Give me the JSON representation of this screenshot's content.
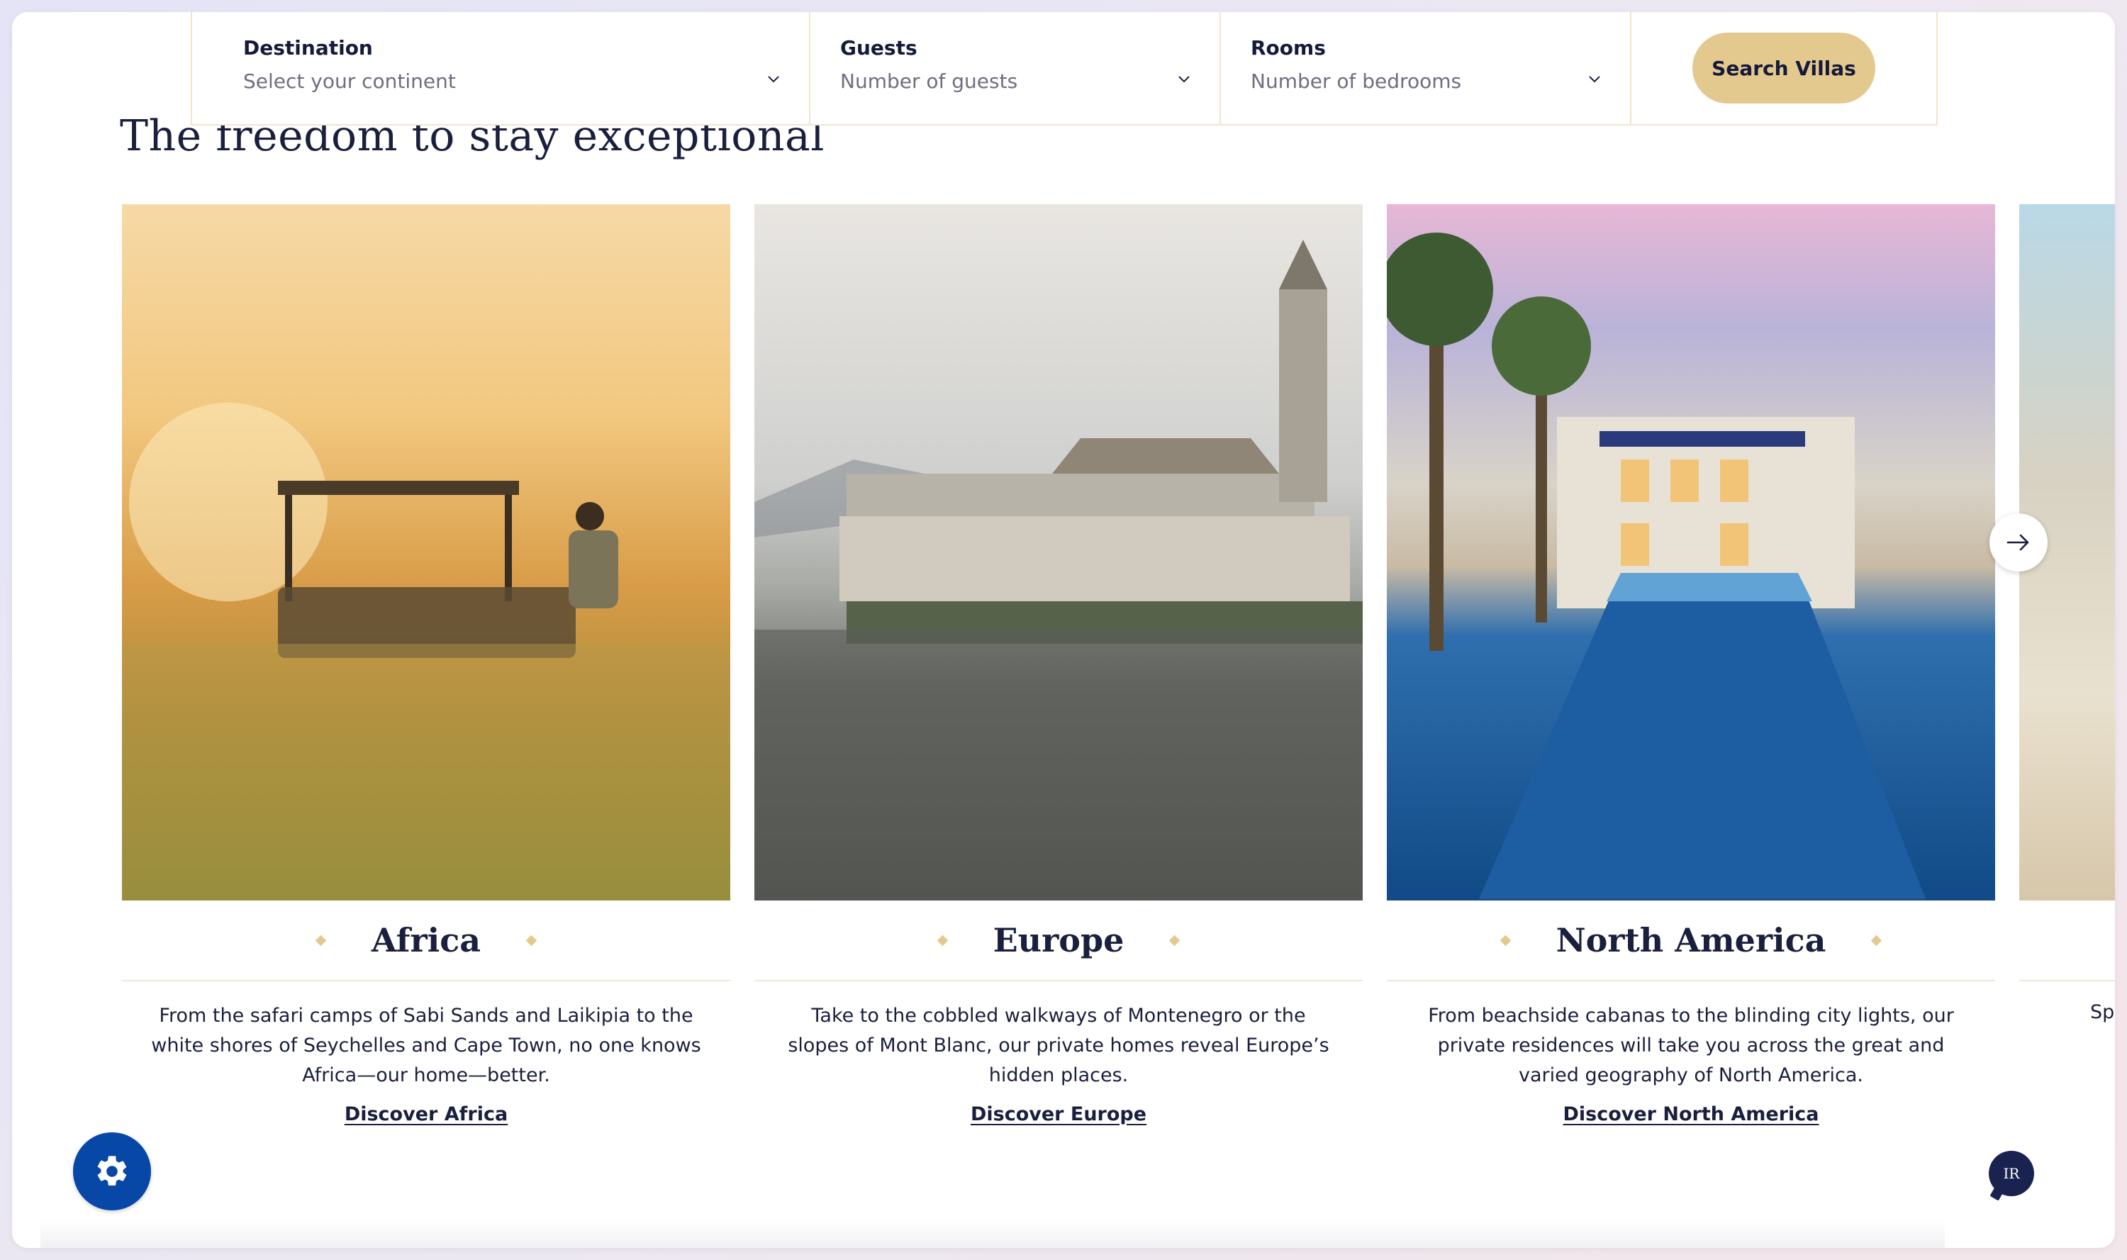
{
  "search": {
    "destination": {
      "label": "Destination",
      "value": "Select your continent"
    },
    "guests": {
      "label": "Guests",
      "value": "Number of guests"
    },
    "rooms": {
      "label": "Rooms",
      "value": "Number of bedrooms"
    },
    "button_label": "Search Villas"
  },
  "section": {
    "heading": "The freedom to stay exceptional"
  },
  "cards": [
    {
      "title": "Africa",
      "description": "From the safari camps of Sabi Sands and Laikipia to the white shores of Seychelles and Cape Town, no one knows Africa—our home—better.",
      "link": "Discover Africa"
    },
    {
      "title": "Europe",
      "description": "Take to the cobbled walkways of Montenegro or the slopes of Mont Blanc, our private homes reveal Europe’s hidden places.",
      "link": "Discover Europe"
    },
    {
      "title": "North America",
      "description": "From beachside cabanas to the blinding city lights, our private residences will take you across the great and varied geography of North America.",
      "link": "Discover North America"
    },
    {
      "partial_text": "Sp"
    }
  ],
  "chat": {
    "label": "IR"
  },
  "colors": {
    "accent_gold": "#e4c98f",
    "navy": "#1a1f3d",
    "settings_blue": "#0747a6"
  },
  "icons": {
    "chevron": "chevron-down-icon",
    "next": "arrow-right-icon",
    "settings": "gear-icon"
  }
}
